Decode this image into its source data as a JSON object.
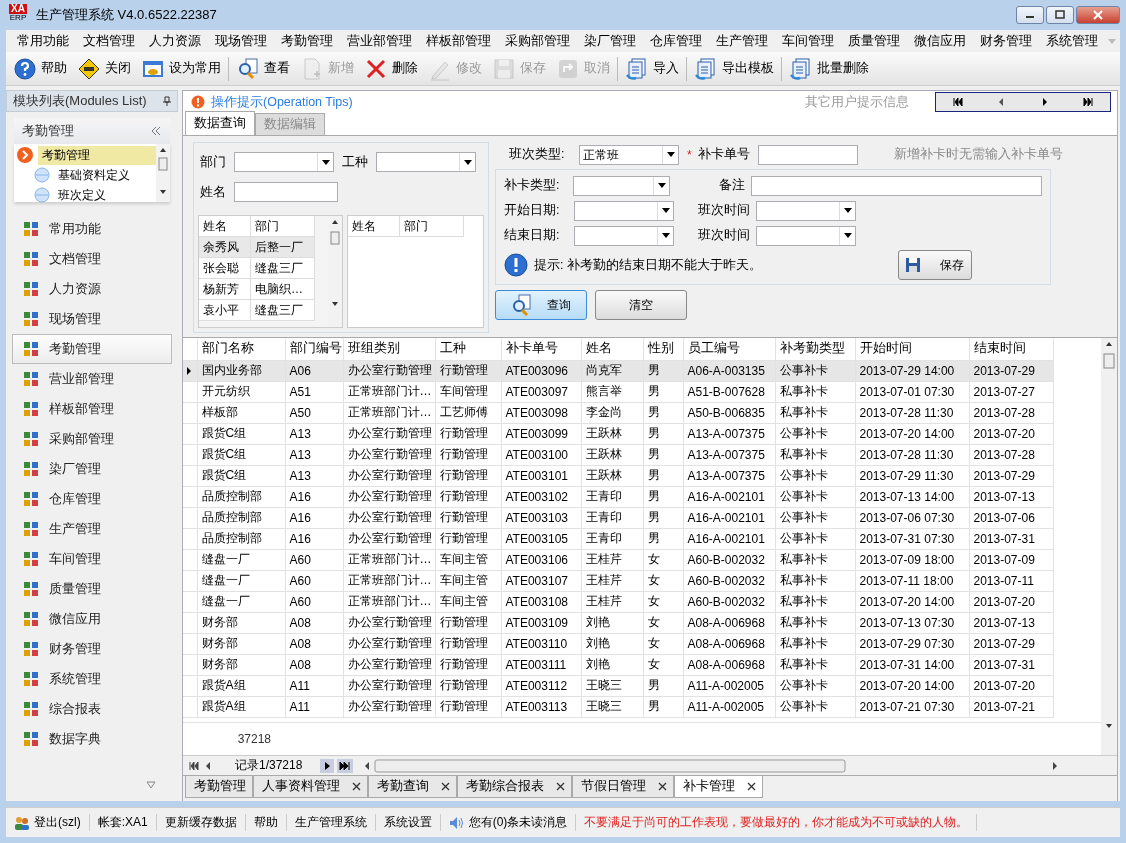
{
  "window": {
    "logo_top": "XA",
    "logo_bottom": "ERP",
    "title": "生产管理系统 V4.0.6522.22387"
  },
  "menu": [
    "常用功能",
    "文档管理",
    "人力资源",
    "现场管理",
    "考勤管理",
    "营业部管理",
    "样板部管理",
    "采购部管理",
    "染厂管理",
    "仓库管理",
    "生产管理",
    "车间管理",
    "质量管理",
    "微信应用",
    "财务管理",
    "系统管理"
  ],
  "toolbar": [
    [
      {
        "label": "帮助",
        "kind": "help",
        "disabled": false
      },
      {
        "label": "关闭",
        "kind": "exit",
        "disabled": false
      },
      {
        "label": "设为常用",
        "kind": "window",
        "disabled": false
      }
    ],
    [
      {
        "label": "查看",
        "kind": "search",
        "disabled": false
      },
      {
        "label": "新增",
        "kind": "doc",
        "disabled": true
      },
      {
        "label": "删除",
        "kind": "x",
        "disabled": false
      },
      {
        "label": "修改",
        "kind": "pencil",
        "disabled": true
      },
      {
        "label": "保存",
        "kind": "disk",
        "disabled": true
      },
      {
        "label": "取消",
        "kind": "undo",
        "disabled": true
      }
    ],
    [
      {
        "label": "导入",
        "kind": "import",
        "disabled": false
      }
    ],
    [
      {
        "label": "导出模板",
        "kind": "import",
        "disabled": false
      }
    ],
    [
      {
        "label": "批量删除",
        "kind": "import",
        "disabled": false
      }
    ]
  ],
  "sidebar": {
    "title": "模块列表(Modules List)",
    "group": "考勤管理",
    "tree": [
      {
        "label": "考勤管理",
        "selected": true,
        "children": [
          {
            "label": "基础资料定义",
            "selected": false
          },
          {
            "label": "班次定义",
            "selected": false
          }
        ]
      }
    ],
    "modules": [
      {
        "label": "常用功能",
        "selected": false
      },
      {
        "label": "文档管理",
        "selected": false
      },
      {
        "label": "人力资源",
        "selected": false
      },
      {
        "label": "现场管理",
        "selected": false
      },
      {
        "label": "考勤管理",
        "selected": true
      },
      {
        "label": "营业部管理",
        "selected": false
      },
      {
        "label": "样板部管理",
        "selected": false
      },
      {
        "label": "采购部管理",
        "selected": false
      },
      {
        "label": "染厂管理",
        "selected": false
      },
      {
        "label": "仓库管理",
        "selected": false
      },
      {
        "label": "生产管理",
        "selected": false
      },
      {
        "label": "车间管理",
        "selected": false
      },
      {
        "label": "质量管理",
        "selected": false
      },
      {
        "label": "微信应用",
        "selected": false
      },
      {
        "label": "财务管理",
        "selected": false
      },
      {
        "label": "系统管理",
        "selected": false
      },
      {
        "label": "综合报表",
        "selected": false
      },
      {
        "label": "数据字典",
        "selected": false
      }
    ]
  },
  "tips": {
    "title": "操作提示(Operation Tips)",
    "other": "其它用户提示信息"
  },
  "inner_tabs": [
    {
      "label": "数据查询",
      "selected": true
    },
    {
      "label": "数据编辑",
      "selected": false
    }
  ],
  "query": {
    "dept_label": "部门",
    "type_label": "工种",
    "name_label": "姓名",
    "left_grid": {
      "columns": [
        "姓名",
        "部门"
      ],
      "rows": [
        {
          "cells": [
            "余秀风",
            "后整一厂"
          ],
          "selected": true
        },
        {
          "cells": [
            "张会聪",
            "缝盘三厂"
          ],
          "selected": false
        },
        {
          "cells": [
            "杨新芳",
            "电脑织…"
          ],
          "selected": false
        },
        {
          "cells": [
            "袁小平",
            "缝盘三厂"
          ],
          "selected": false
        }
      ]
    },
    "right_grid": {
      "columns": [
        "姓名",
        "部门"
      ]
    }
  },
  "form": {
    "shift_type_label": "班次类型:",
    "shift_type_value": "正常班",
    "required_mark": "*",
    "card_no_label": "补卡单号",
    "card_no_hint": "新增补卡时无需输入补卡单号",
    "card_type_label": "补卡类型:",
    "remark_label": "备注",
    "start_label": "开始日期:",
    "start_time_label": "班次时间",
    "end_label": "结束日期:",
    "end_time_label": "班次时间",
    "tip": "提示: 补考勤的结束日期不能大于昨天。",
    "save": "保存",
    "query": "查询",
    "clear": "清空"
  },
  "table": {
    "columns": [
      "部门名称",
      "部门编号",
      "班组类别",
      "工种",
      "补卡单号",
      "姓名",
      "性别",
      "员工编号",
      "补考勤类型",
      "开始时间",
      "结束时间"
    ],
    "rows": [
      {
        "selected": true,
        "cells": [
          "国内业务部",
          "A06",
          "办公室行勤管理",
          "行勤管理",
          "ATE003096",
          "尚克军",
          "男",
          "A06-A-003135",
          "公事补卡",
          "2013-07-29 14:00",
          "2013-07-29"
        ]
      },
      {
        "selected": false,
        "cells": [
          "开元纺织",
          "A51",
          "正常班部门计…",
          "车间管理",
          "ATE003097",
          "熊言举",
          "男",
          "A51-B-007628",
          "私事补卡",
          "2013-07-01 07:30",
          "2013-07-27"
        ]
      },
      {
        "selected": false,
        "cells": [
          "样板部",
          "A50",
          "正常班部门计…",
          "工艺师傅",
          "ATE003098",
          "李金尚",
          "男",
          "A50-B-006835",
          "私事补卡",
          "2013-07-28 11:30",
          "2013-07-28"
        ]
      },
      {
        "selected": false,
        "cells": [
          "跟货C组",
          "A13",
          "办公室行勤管理",
          "行勤管理",
          "ATE003099",
          "王跃林",
          "男",
          "A13-A-007375",
          "公事补卡",
          "2013-07-20 14:00",
          "2013-07-20"
        ]
      },
      {
        "selected": false,
        "cells": [
          "跟货C组",
          "A13",
          "办公室行勤管理",
          "行勤管理",
          "ATE003100",
          "王跃林",
          "男",
          "A13-A-007375",
          "私事补卡",
          "2013-07-28 11:30",
          "2013-07-28"
        ]
      },
      {
        "selected": false,
        "cells": [
          "跟货C组",
          "A13",
          "办公室行勤管理",
          "行勤管理",
          "ATE003101",
          "王跃林",
          "男",
          "A13-A-007375",
          "公事补卡",
          "2013-07-29 11:30",
          "2013-07-29"
        ]
      },
      {
        "selected": false,
        "cells": [
          "品质控制部",
          "A16",
          "办公室行勤管理",
          "行勤管理",
          "ATE003102",
          "王青印",
          "男",
          "A16-A-002101",
          "公事补卡",
          "2013-07-13 14:00",
          "2013-07-13"
        ]
      },
      {
        "selected": false,
        "cells": [
          "品质控制部",
          "A16",
          "办公室行勤管理",
          "行勤管理",
          "ATE003103",
          "王青印",
          "男",
          "A16-A-002101",
          "公事补卡",
          "2013-07-06 07:30",
          "2013-07-06"
        ]
      },
      {
        "selected": false,
        "cells": [
          "品质控制部",
          "A16",
          "办公室行勤管理",
          "行勤管理",
          "ATE003105",
          "王青印",
          "男",
          "A16-A-002101",
          "公事补卡",
          "2013-07-31 07:30",
          "2013-07-31"
        ]
      },
      {
        "selected": false,
        "cells": [
          "缝盘一厂",
          "A60",
          "正常班部门计…",
          "车间主管",
          "ATE003106",
          "王桂芹",
          "女",
          "A60-B-002032",
          "私事补卡",
          "2013-07-09 18:00",
          "2013-07-09"
        ]
      },
      {
        "selected": false,
        "cells": [
          "缝盘一厂",
          "A60",
          "正常班部门计…",
          "车间主管",
          "ATE003107",
          "王桂芹",
          "女",
          "A60-B-002032",
          "私事补卡",
          "2013-07-11 18:00",
          "2013-07-11"
        ]
      },
      {
        "selected": false,
        "cells": [
          "缝盘一厂",
          "A60",
          "正常班部门计…",
          "车间主管",
          "ATE003108",
          "王桂芹",
          "女",
          "A60-B-002032",
          "私事补卡",
          "2013-07-20 14:00",
          "2013-07-20"
        ]
      },
      {
        "selected": false,
        "cells": [
          "财务部",
          "A08",
          "办公室行勤管理",
          "行勤管理",
          "ATE003109",
          "刘艳",
          "女",
          "A08-A-006968",
          "私事补卡",
          "2013-07-13 07:30",
          "2013-07-13"
        ]
      },
      {
        "selected": false,
        "cells": [
          "财务部",
          "A08",
          "办公室行勤管理",
          "行勤管理",
          "ATE003110",
          "刘艳",
          "女",
          "A08-A-006968",
          "私事补卡",
          "2013-07-29 07:30",
          "2013-07-29"
        ]
      },
      {
        "selected": false,
        "cells": [
          "财务部",
          "A08",
          "办公室行勤管理",
          "行勤管理",
          "ATE003111",
          "刘艳",
          "女",
          "A08-A-006968",
          "私事补卡",
          "2013-07-31 14:00",
          "2013-07-31"
        ]
      },
      {
        "selected": false,
        "cells": [
          "跟货A组",
          "A11",
          "办公室行勤管理",
          "行勤管理",
          "ATE003112",
          "王晓三",
          "男",
          "A11-A-002005",
          "公事补卡",
          "2013-07-20 14:00",
          "2013-07-20"
        ]
      },
      {
        "selected": false,
        "cells": [
          "跟货A组",
          "A11",
          "办公室行勤管理",
          "行勤管理",
          "ATE003113",
          "王晓三",
          "男",
          "A11-A-002005",
          "公事补卡",
          "2013-07-21 07:30",
          "2013-07-21"
        ]
      }
    ],
    "total": "37218",
    "record": "记录1/37218"
  },
  "doc_tabs": [
    {
      "label": "考勤管理",
      "closable": false,
      "selected": false
    },
    {
      "label": "人事资料管理",
      "closable": true,
      "selected": false
    },
    {
      "label": "考勤查询",
      "closable": true,
      "selected": false
    },
    {
      "label": "考勤综合报表",
      "closable": true,
      "selected": false
    },
    {
      "label": "节假日管理",
      "closable": true,
      "selected": false
    },
    {
      "label": "补卡管理",
      "closable": true,
      "selected": true
    }
  ],
  "status_bar": {
    "logout": "登出(szl)",
    "account": "帐套:XA1",
    "items": [
      "更新缓存数据",
      "帮助",
      "生产管理系统",
      "系统设置"
    ],
    "messages": "您有(0)条未读消息",
    "motto": "不要满足于尚可的工作表现，要做最好的，你才能成为不可或缺的人物。"
  }
}
